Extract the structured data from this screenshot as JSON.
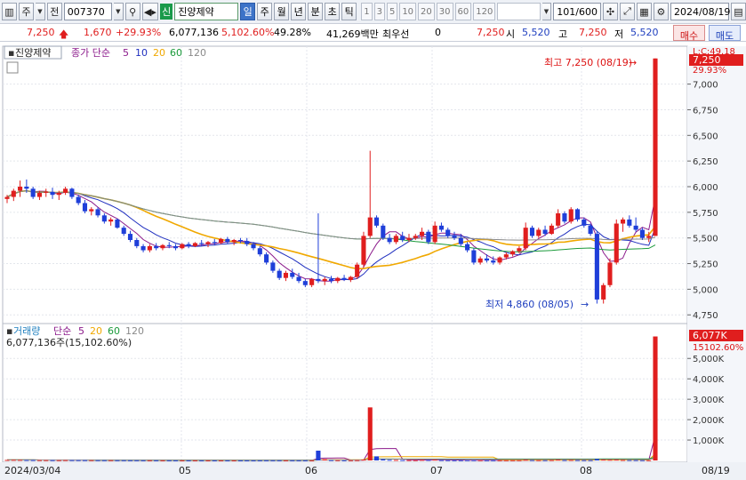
{
  "toolbar": {
    "type_label": "주",
    "market_label": "전",
    "code": "007370",
    "sin_badge": "신",
    "stock_name": "진양제약",
    "periods": [
      "일",
      "주",
      "월",
      "년",
      "분",
      "초",
      "틱"
    ],
    "active_period": "일",
    "minute_numbers": [
      "1",
      "3",
      "5",
      "10",
      "20",
      "30",
      "60",
      "120"
    ],
    "count_value": "101",
    "count_total": "/600",
    "date": "2024/08/19"
  },
  "info": {
    "price": "7,250",
    "change": "1,670",
    "change_pct": "+29.93%",
    "volume": "6,077,136",
    "volume_ratio": "5,102.60%",
    "turnover": "49.28%",
    "amount": "41,269백만",
    "bid_label": "최우선",
    "bid_value": "0",
    "best_price": "7,250",
    "open_label": "시",
    "open_value": "5,520",
    "high_label": "고",
    "high_value": "7,250",
    "low_label": "저",
    "low_value": "5,520",
    "buy_label": "매수",
    "sell_label": "매도"
  },
  "price_panel": {
    "name": "진양제약",
    "ma_label": "종가 단순",
    "ma_periods": [
      "5",
      "10",
      "20",
      "60",
      "120"
    ],
    "ma_colors": [
      "#8b1a8b",
      "#1f2fbf",
      "#f0a800",
      "#1a9a3a",
      "#8a8a8a"
    ],
    "price_axis": [
      "7,000",
      "6,750",
      "6,500",
      "6,250",
      "6,000",
      "5,750",
      "5,500",
      "5,250",
      "5,000",
      "4,750"
    ],
    "upper_limit_label": "L:C:49.18",
    "current_price_tag": "7,250",
    "current_pct_tag": "29.93%",
    "high_annotation": "최고 7,250 (08/19)",
    "low_annotation": "최저 4,860 (08/05)"
  },
  "volume_panel": {
    "label": "거래량",
    "ma_label": "단순",
    "ma_periods": [
      "5",
      "20",
      "60",
      "120"
    ],
    "ma_colors": [
      "#8b1a8b",
      "#f0a800",
      "#1a9a3a",
      "#8a8a8a"
    ],
    "value_text": "6,077,136주(15,102.60%)",
    "volume_axis": [
      "5,000K",
      "4,000K",
      "3,000K",
      "2,000K",
      "1,000K"
    ],
    "volume_tag": "6,077K",
    "volume_pct_tag": "15102.60%"
  },
  "x_axis": {
    "labels": [
      "2024/03/04",
      "05",
      "06",
      "07",
      "08"
    ],
    "right_label": "08/19"
  },
  "chart_data": {
    "type": "candlestick",
    "candles_desc": "daily OHLC for 진양제약 (007370), 2024/03/04 to 2024/08/19, approximate values read off the price axis",
    "y_range": [
      4700,
      7300
    ],
    "volume_range": [
      0,
      6100000
    ],
    "candles": [
      [
        5880,
        5920,
        5840,
        5900
      ],
      [
        5900,
        5980,
        5860,
        5960
      ],
      [
        5960,
        6060,
        5900,
        6000
      ],
      [
        6000,
        6070,
        5940,
        5980
      ],
      [
        5980,
        6000,
        5880,
        5900
      ],
      [
        5900,
        5960,
        5870,
        5940
      ],
      [
        5940,
        5980,
        5900,
        5950
      ],
      [
        5950,
        5990,
        5880,
        5920
      ],
      [
        5920,
        5960,
        5870,
        5940
      ],
      [
        5940,
        6000,
        5920,
        5980
      ],
      [
        5980,
        5990,
        5880,
        5900
      ],
      [
        5900,
        5920,
        5820,
        5840
      ],
      [
        5840,
        5870,
        5740,
        5760
      ],
      [
        5760,
        5800,
        5720,
        5780
      ],
      [
        5780,
        5800,
        5700,
        5720
      ],
      [
        5720,
        5740,
        5640,
        5660
      ],
      [
        5660,
        5700,
        5620,
        5680
      ],
      [
        5680,
        5690,
        5590,
        5600
      ],
      [
        5600,
        5620,
        5520,
        5540
      ],
      [
        5540,
        5570,
        5460,
        5480
      ],
      [
        5480,
        5500,
        5400,
        5420
      ],
      [
        5420,
        5440,
        5360,
        5380
      ],
      [
        5380,
        5440,
        5360,
        5420
      ],
      [
        5420,
        5450,
        5380,
        5400
      ],
      [
        5400,
        5440,
        5380,
        5430
      ],
      [
        5430,
        5460,
        5400,
        5420
      ],
      [
        5420,
        5440,
        5380,
        5400
      ],
      [
        5400,
        5450,
        5390,
        5440
      ],
      [
        5440,
        5460,
        5400,
        5420
      ],
      [
        5420,
        5460,
        5410,
        5450
      ],
      [
        5450,
        5480,
        5420,
        5440
      ],
      [
        5440,
        5470,
        5410,
        5460
      ],
      [
        5460,
        5490,
        5430,
        5450
      ],
      [
        5450,
        5500,
        5440,
        5490
      ],
      [
        5490,
        5510,
        5440,
        5460
      ],
      [
        5460,
        5490,
        5430,
        5480
      ],
      [
        5480,
        5500,
        5450,
        5470
      ],
      [
        5470,
        5500,
        5420,
        5440
      ],
      [
        5440,
        5460,
        5380,
        5400
      ],
      [
        5400,
        5420,
        5320,
        5340
      ],
      [
        5340,
        5360,
        5240,
        5260
      ],
      [
        5260,
        5280,
        5160,
        5180
      ],
      [
        5180,
        5200,
        5090,
        5110
      ],
      [
        5110,
        5180,
        5080,
        5160
      ],
      [
        5160,
        5200,
        5100,
        5120
      ],
      [
        5120,
        5160,
        5060,
        5080
      ],
      [
        5080,
        5100,
        5020,
        5040
      ],
      [
        5040,
        5110,
        5020,
        5100
      ],
      [
        5100,
        5740,
        5060,
        5080
      ],
      [
        5080,
        5120,
        5040,
        5100
      ],
      [
        5100,
        5130,
        5060,
        5080
      ],
      [
        5080,
        5120,
        5060,
        5110
      ],
      [
        5110,
        5140,
        5080,
        5090
      ],
      [
        5090,
        5130,
        5070,
        5120
      ],
      [
        5120,
        5260,
        5100,
        5240
      ],
      [
        5240,
        5560,
        5220,
        5520
      ],
      [
        5520,
        6350,
        5500,
        5700
      ],
      [
        5700,
        5720,
        5600,
        5620
      ],
      [
        5620,
        5640,
        5480,
        5500
      ],
      [
        5500,
        5540,
        5440,
        5460
      ],
      [
        5460,
        5540,
        5440,
        5520
      ],
      [
        5520,
        5560,
        5460,
        5480
      ],
      [
        5480,
        5540,
        5460,
        5500
      ],
      [
        5500,
        5540,
        5480,
        5520
      ],
      [
        5520,
        5600,
        5480,
        5560
      ],
      [
        5560,
        5580,
        5440,
        5460
      ],
      [
        5460,
        5660,
        5440,
        5620
      ],
      [
        5620,
        5650,
        5560,
        5580
      ],
      [
        5580,
        5600,
        5500,
        5520
      ],
      [
        5520,
        5560,
        5480,
        5500
      ],
      [
        5500,
        5540,
        5420,
        5440
      ],
      [
        5440,
        5460,
        5360,
        5380
      ],
      [
        5380,
        5400,
        5240,
        5260
      ],
      [
        5260,
        5320,
        5240,
        5300
      ],
      [
        5300,
        5340,
        5260,
        5280
      ],
      [
        5280,
        5320,
        5240,
        5260
      ],
      [
        5260,
        5320,
        5240,
        5310
      ],
      [
        5310,
        5360,
        5290,
        5340
      ],
      [
        5340,
        5380,
        5320,
        5370
      ],
      [
        5370,
        5420,
        5350,
        5400
      ],
      [
        5400,
        5650,
        5380,
        5600
      ],
      [
        5600,
        5620,
        5500,
        5520
      ],
      [
        5520,
        5600,
        5500,
        5580
      ],
      [
        5580,
        5620,
        5520,
        5540
      ],
      [
        5540,
        5640,
        5530,
        5620
      ],
      [
        5620,
        5780,
        5600,
        5740
      ],
      [
        5740,
        5760,
        5640,
        5660
      ],
      [
        5660,
        5800,
        5640,
        5780
      ],
      [
        5780,
        5790,
        5660,
        5680
      ],
      [
        5680,
        5700,
        5600,
        5620
      ],
      [
        5620,
        5640,
        5520,
        5540
      ],
      [
        5540,
        5560,
        4860,
        4900
      ],
      [
        4900,
        5060,
        4860,
        5040
      ],
      [
        5040,
        5300,
        5020,
        5260
      ],
      [
        5260,
        5680,
        5240,
        5640
      ],
      [
        5640,
        5700,
        5560,
        5680
      ],
      [
        5680,
        5720,
        5600,
        5620
      ],
      [
        5620,
        5700,
        5560,
        5580
      ],
      [
        5580,
        5600,
        5480,
        5500
      ],
      [
        5500,
        5560,
        5460,
        5520
      ],
      [
        5520,
        7250,
        5520,
        7250
      ]
    ],
    "volumes": [
      25000,
      30000,
      28000,
      22000,
      20000,
      18000,
      17000,
      16000,
      15000,
      18000,
      17000,
      16000,
      15000,
      14000,
      13000,
      12000,
      12000,
      11000,
      11000,
      10000,
      10000,
      9000,
      9000,
      8000,
      8000,
      8000,
      7000,
      7000,
      7000,
      7000,
      7000,
      6000,
      6000,
      6000,
      6000,
      6000,
      6000,
      6000,
      6000,
      7000,
      8000,
      9000,
      9000,
      8000,
      8000,
      7000,
      7000,
      7000,
      480000,
      60000,
      20000,
      15000,
      12000,
      10000,
      15000,
      40000,
      2600000,
      200000,
      60000,
      30000,
      25000,
      20000,
      18000,
      16000,
      30000,
      25000,
      40000,
      20000,
      15000,
      12000,
      12000,
      14000,
      14000,
      12000,
      10000,
      10000,
      10000,
      10000,
      10000,
      12000,
      35000,
      18000,
      15000,
      14000,
      20000,
      40000,
      20000,
      25000,
      20000,
      15000,
      15000,
      70000,
      40000,
      35000,
      40000,
      25000,
      20000,
      18000,
      15000,
      14000,
      6077136
    ]
  }
}
